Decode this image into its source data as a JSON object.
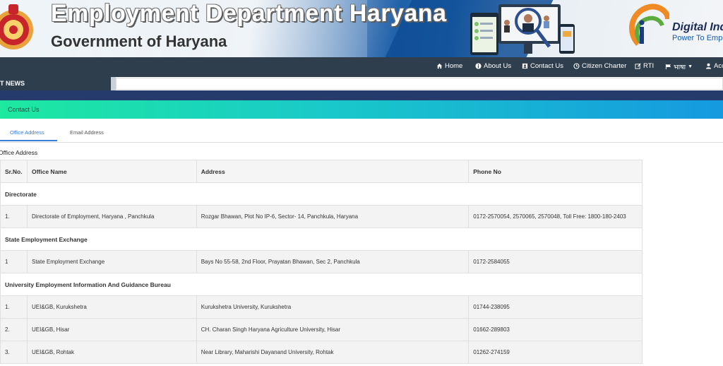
{
  "header": {
    "title": "Employment Department Haryana",
    "subtitle": "Government of Haryana",
    "digital_india_title": "Digital Ind",
    "digital_india_tagline": "Power To Empow"
  },
  "nav": {
    "items": [
      {
        "label": "Home",
        "icon": "home-icon"
      },
      {
        "label": "About Us",
        "icon": "info-icon"
      },
      {
        "label": "Contact Us",
        "icon": "contact-card-icon"
      },
      {
        "label": "Citizen Charter",
        "icon": "clock-icon"
      },
      {
        "label": "RTI",
        "icon": "edit-icon"
      },
      {
        "label": "भाषा",
        "icon": "flag-icon"
      },
      {
        "label": "Acco",
        "icon": "user-icon"
      }
    ]
  },
  "news": {
    "label": "T NEWS"
  },
  "page_heading": "Contact Us",
  "tabs": [
    {
      "label": "Office Address",
      "active": true
    },
    {
      "label": "Email Address",
      "active": false
    }
  ],
  "section_title": "Office Address",
  "table": {
    "columns": [
      "Sr.No.",
      "Office Name",
      "Address",
      "Phone No"
    ],
    "groups": [
      {
        "name": "Directorate",
        "rows": [
          {
            "sr": "1.",
            "office": "Directorate of Employment, Haryana , Panchkula",
            "address": "Rozgar Bhawan, Plot No IP-6, Sector- 14, Panchkula, Haryana",
            "phone": "0172-2570054, 2570065, 2570048, Toll Free: 1800-180-2403"
          }
        ]
      },
      {
        "name": "State Employment Exchange",
        "rows": [
          {
            "sr": "1",
            "office": "State Employment Exchange",
            "address": "Bays No 55-58, 2nd Floor, Prayatan Bhawan, Sec 2, Panchkula",
            "phone": "0172-2584055"
          }
        ]
      },
      {
        "name": "University Employment Information And Guidance Bureau",
        "rows": [
          {
            "sr": "1.",
            "office": "UEI&GB, Kurukshetra",
            "address": "Kurukshetra University, Kurukshetra",
            "phone": "01744-238095"
          },
          {
            "sr": "2.",
            "office": "UEI&GB, Hisar",
            "address": "CH. Charan Singh Haryana Agriculture University, Hisar",
            "phone": "01662-289803"
          },
          {
            "sr": "3.",
            "office": "UEI&GB, Rohtak",
            "address": "Near Library, Maharishi Dayanand University, Rohtak",
            "phone": "01262-274159"
          }
        ]
      }
    ]
  }
}
